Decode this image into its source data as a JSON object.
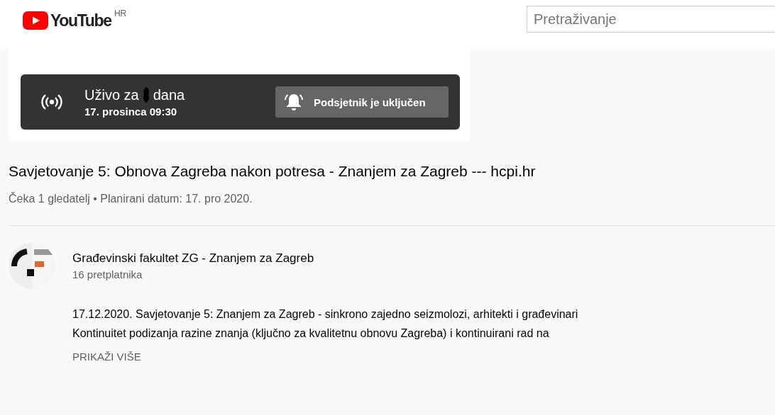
{
  "header": {
    "logo_text": "YouTube",
    "region": "HR",
    "search": {
      "placeholder": "Pretraživanje"
    }
  },
  "live_banner": {
    "title_before": "Uživo za",
    "redacted": true,
    "title_after": "dana",
    "date": "17. prosinca 09:30",
    "reminder_button": {
      "label": "Podsjetnik je uključen",
      "on": true
    }
  },
  "video": {
    "title": "Savjetovanje 5: Obnova Zagreba nakon potresa - Znanjem za Zagreb --- hcpi.hr",
    "meta": "Čeka 1 gledatelj • Planirani datum: 17. pro 2020."
  },
  "channel": {
    "name": "Građevinski fakultet ZG - Znanjem za Zagreb",
    "subscribers": "16 pretplatnika"
  },
  "description": {
    "lines": [
      "17.12.2020. Savjetovanje 5: Znanjem za Zagreb - sinkrono zajedno seizmolozi, arhitekti i građevinari",
      "Kontinuitet podizanja razine znanja (ključno za kvalitetnu obnovu Zagreba) i kontinuirani rad na"
    ],
    "show_more": "PRIKAŽI VIŠE"
  }
}
